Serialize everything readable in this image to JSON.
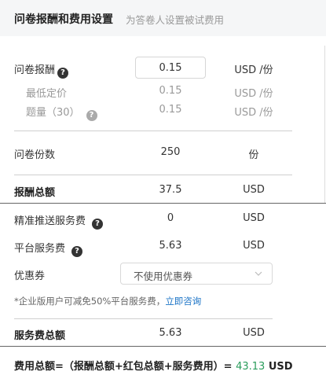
{
  "header": {
    "title": "问卷报酬和费用设置",
    "subtitle": "为答卷人设置被试费用"
  },
  "reward": {
    "label": "问卷报酬",
    "input_value": "0.15",
    "unit": "USD /份",
    "min_price": {
      "label": "最低定价",
      "value": "0.15",
      "unit": "USD /份"
    },
    "question_count": {
      "label": "题量（30）",
      "value": "0.15",
      "unit": "USD /份"
    }
  },
  "copies": {
    "label": "问卷份数",
    "value": "250",
    "unit": "份"
  },
  "reward_total": {
    "label": "报酬总额",
    "value": "37.5",
    "unit": "USD"
  },
  "push_fee": {
    "label": "精准推送服务费",
    "value": "0",
    "unit": "USD"
  },
  "platform_fee": {
    "label": "平台服务费",
    "value": "5.63",
    "unit": "USD"
  },
  "coupon": {
    "label": "优惠券",
    "selected": "不使用优惠券"
  },
  "note": {
    "text": "*企业版用户可减免50%平台服务费，",
    "link": "立即咨询"
  },
  "service_total": {
    "label": "服务费总额",
    "value": "5.63",
    "unit": "USD"
  },
  "grand_total": {
    "label": "费用总额=（报酬总额+红包总额+服务费用）=",
    "value": "43.13",
    "unit": "USD"
  },
  "colors": {
    "accent_green": "#2a9d5c",
    "link_blue": "#1a73c6"
  }
}
